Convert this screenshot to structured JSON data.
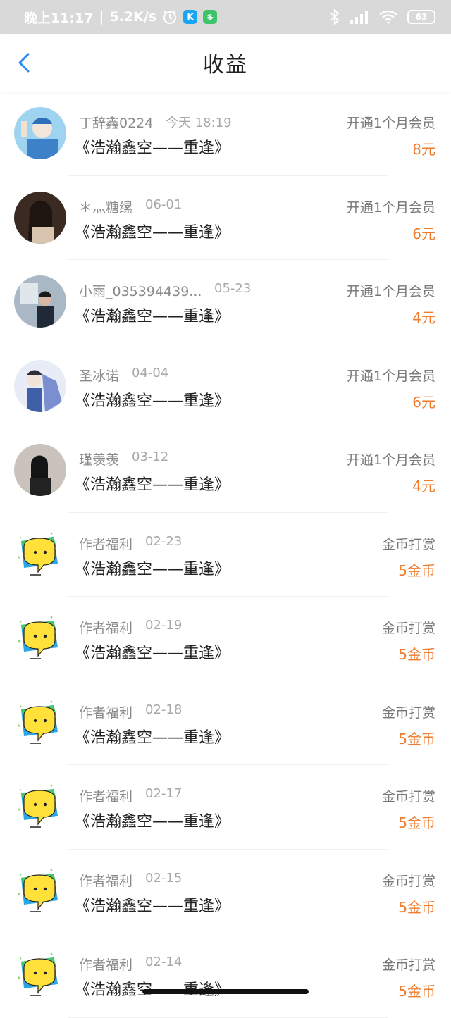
{
  "status_bar": {
    "time": "晚上11:17",
    "separator": "|",
    "speed": "5.2K/s",
    "battery": "63",
    "colors": {
      "bg": "#d9d9d9",
      "app1": "#1aa5f3",
      "app2": "#3cc46a"
    },
    "icons": [
      "alarm-icon",
      "app-k-icon",
      "app-green-icon",
      "bluetooth-icon",
      "signal-icon",
      "wifi-icon",
      "battery-icon"
    ]
  },
  "header": {
    "title": "收益",
    "back_icon": "chevron-left-icon",
    "accent": "#2a8cf0"
  },
  "rows": [
    {
      "name": "丁辞鑫0224",
      "date": "今天 18:19",
      "title": "《浩瀚鑫空——重逢》",
      "type": "开通1个月会员",
      "amount": "8元",
      "avatar": "photo-blue"
    },
    {
      "name": "＊灬糖缧",
      "date": "06-01",
      "title": "《浩瀚鑫空——重逢》",
      "type": "开通1个月会员",
      "amount": "6元",
      "avatar": "photo-dark"
    },
    {
      "name": "小雨_035394439...",
      "date": "05-23",
      "title": "《浩瀚鑫空——重逢》",
      "type": "开通1个月会员",
      "amount": "4元",
      "avatar": "photo-room"
    },
    {
      "name": "圣冰诺",
      "date": "04-04",
      "title": "《浩瀚鑫空——重逢》",
      "type": "开通1个月会员",
      "amount": "6元",
      "avatar": "photo-anime"
    },
    {
      "name": "瑾羡羡",
      "date": "03-12",
      "title": "《浩瀚鑫空——重逢》",
      "type": "开通1个月会员",
      "amount": "4元",
      "avatar": "photo-grey"
    },
    {
      "name": "作者福利",
      "date": "02-23",
      "title": "《浩瀚鑫空——重逢》",
      "type": "金币打赏",
      "amount": "5金币",
      "avatar": "chat-bubble"
    },
    {
      "name": "作者福利",
      "date": "02-19",
      "title": "《浩瀚鑫空——重逢》",
      "type": "金币打赏",
      "amount": "5金币",
      "avatar": "chat-bubble"
    },
    {
      "name": "作者福利",
      "date": "02-18",
      "title": "《浩瀚鑫空——重逢》",
      "type": "金币打赏",
      "amount": "5金币",
      "avatar": "chat-bubble"
    },
    {
      "name": "作者福利",
      "date": "02-17",
      "title": "《浩瀚鑫空——重逢》",
      "type": "金币打赏",
      "amount": "5金币",
      "avatar": "chat-bubble"
    },
    {
      "name": "作者福利",
      "date": "02-15",
      "title": "《浩瀚鑫空——重逢》",
      "type": "金币打赏",
      "amount": "5金币",
      "avatar": "chat-bubble"
    },
    {
      "name": "作者福利",
      "date": "02-14",
      "title": "《浩瀚鑫空——重逢》",
      "type": "金币打赏",
      "amount": "5金币",
      "avatar": "chat-bubble"
    }
  ],
  "amount_color": "#f07b2b"
}
